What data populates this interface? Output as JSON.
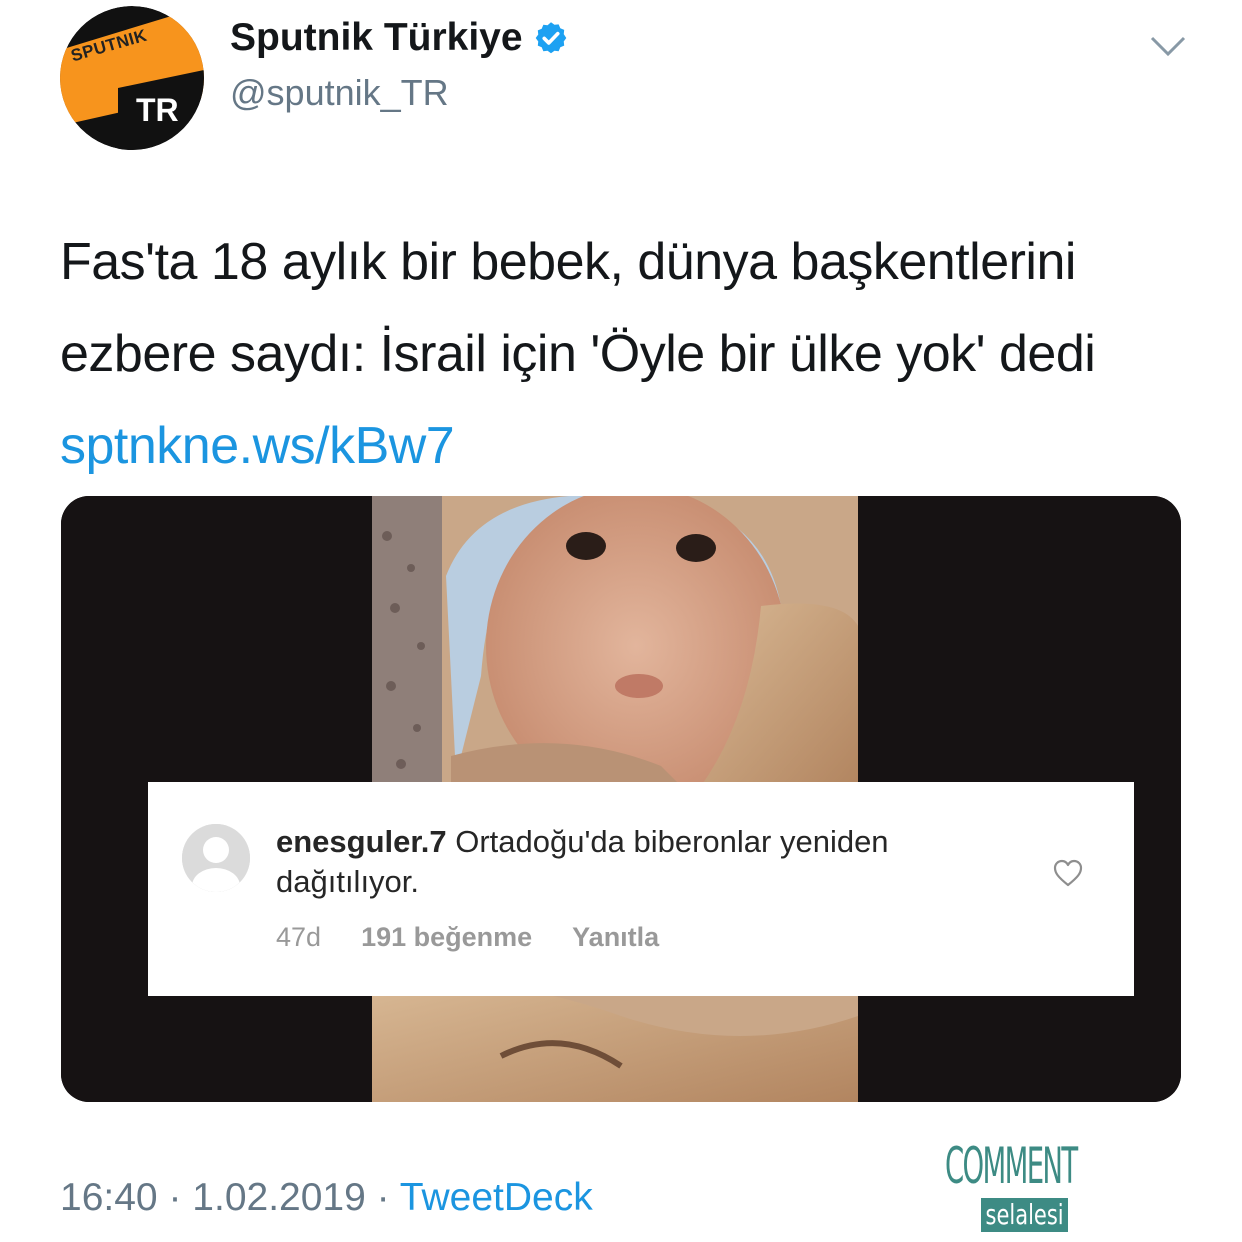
{
  "author": {
    "name": "Sputnik Türkiye",
    "handle": "@sputnik_TR",
    "avatar_brand_text": "SPUTNIK",
    "avatar_brand_sub": "TR",
    "verified": true
  },
  "tweet": {
    "text": "Fas'ta 18 aylık bir bebek, dünya başkentlerini ezbere saydı: İsrail için 'Öyle bir ülke yok' dedi",
    "link": "sptnkne.ws/kBw7"
  },
  "media": {
    "overlay_comment": {
      "username": "enesguler.7",
      "text": "Ortadoğu'da biberonlar yeniden dağıtılıyor.",
      "age": "47d",
      "likes": "191 beğenme",
      "reply_label": "Yanıtla"
    }
  },
  "footer": {
    "time": "16:40",
    "date": "1.02.2019",
    "separator": "·",
    "app": "TweetDeck"
  },
  "watermark": {
    "top": "COMMENT",
    "bottom": "selalesi"
  },
  "colors": {
    "link": "#1b95e0",
    "verified": "#1da1f2",
    "brand_orange": "#f7941d",
    "watermark": "#3d8b84"
  },
  "icons": {
    "verified": "verified-badge-icon",
    "chevron": "chevron-down-icon",
    "heart": "heart-outline-icon",
    "user": "default-user-avatar-icon"
  }
}
